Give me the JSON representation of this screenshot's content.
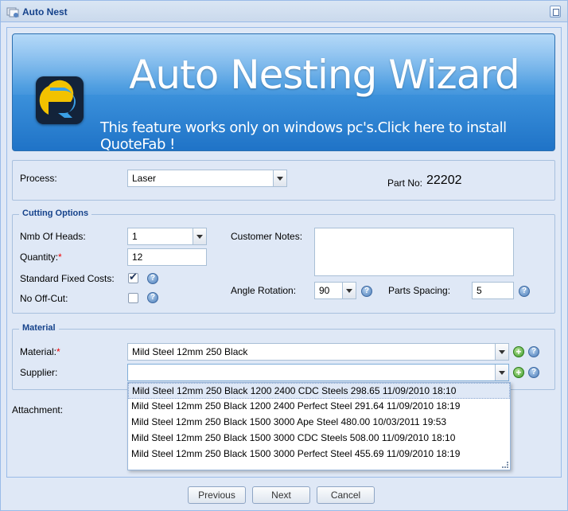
{
  "window": {
    "title": "Auto Nest"
  },
  "banner": {
    "title": "Auto Nesting Wizard",
    "link": "This feature works only on windows pc's.Click here to install QuoteFab !"
  },
  "process": {
    "label": "Process:",
    "value": "Laser",
    "part_no_label": "Part No:",
    "part_no_value": "22202"
  },
  "cutting": {
    "legend": "Cutting Options",
    "heads_label": "Nmb Of Heads:",
    "heads_value": "1",
    "quantity_label": "Quantity:",
    "quantity_value": "12",
    "fixed_costs_label": "Standard Fixed Costs:",
    "fixed_costs_checked": true,
    "offcut_label": "No Off-Cut:",
    "offcut_checked": false,
    "notes_label": "Customer Notes:",
    "notes_value": "",
    "angle_label": "Angle Rotation:",
    "angle_value": "90",
    "spacing_label": "Parts Spacing:",
    "spacing_value": "5"
  },
  "material": {
    "legend": "Material",
    "material_label": "Material:",
    "material_value": "Mild Steel 12mm 250 Black",
    "supplier_label": "Supplier:",
    "supplier_value": "",
    "attachment_label": "Attachment:",
    "supplier_options": [
      "Mild Steel 12mm 250 Black 1200 2400 CDC Steels 298.65 11/09/2010 18:10",
      "Mild Steel 12mm 250 Black 1200 2400 Perfect Steel 291.64 11/09/2010 18:19",
      "Mild Steel 12mm 250 Black 1500 3000 Ape Steel 480.00 10/03/2011 19:53",
      "Mild Steel 12mm 250 Black 1500 3000 CDC Steels 508.00 11/09/2010 18:10",
      "Mild Steel 12mm 250 Black 1500 3000 Perfect Steel 455.69 11/09/2010 18:19"
    ]
  },
  "buttons": {
    "previous": "Previous",
    "next": "Next",
    "cancel": "Cancel"
  },
  "icons": {
    "help": "?",
    "add": "+"
  },
  "colors": {
    "title": "#15428b",
    "banner": "#3f95de",
    "required": "#ee0000"
  }
}
